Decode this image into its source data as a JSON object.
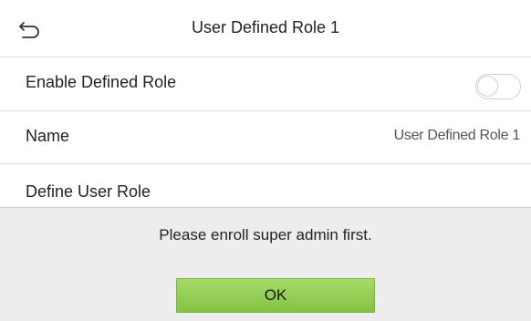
{
  "header": {
    "title": "User Defined Role 1",
    "back_icon": "back-arrow-icon"
  },
  "settings": {
    "enable_defined_role": {
      "label": "Enable Defined Role",
      "toggle_state": "off"
    },
    "name": {
      "label": "Name",
      "value": "User Defined Role 1"
    },
    "define_user_role": {
      "label": "Define User Role"
    }
  },
  "dialog": {
    "message": "Please enroll super admin first.",
    "ok_label": "OK"
  },
  "colors": {
    "ok_button_top": "#a6da6a",
    "ok_button_bottom": "#84c243",
    "dialog_background": "#ededed",
    "divider": "#dcdcdc"
  }
}
